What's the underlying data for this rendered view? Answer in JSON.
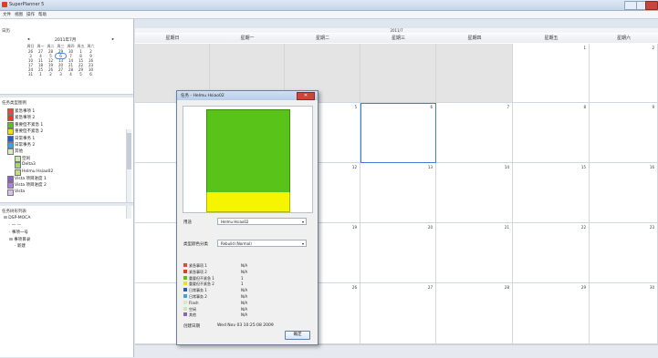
{
  "window": {
    "title": "SuperPlanner 5"
  },
  "menu": [
    "文件",
    "视图",
    "操作",
    "帮助"
  ],
  "sidebar": {
    "calendar_title": "日历",
    "mini_calendar": {
      "month_label": "2011年7月",
      "prev": "◂",
      "next": "▸",
      "weekdays": [
        "周日",
        "周一",
        "周二",
        "周三",
        "周四",
        "周五",
        "周六"
      ],
      "weeks": [
        [
          "26",
          "27",
          "28",
          "29",
          "30",
          "1",
          "2"
        ],
        [
          "3",
          "4",
          "5",
          "6",
          "7",
          "8",
          "9"
        ],
        [
          "10",
          "11",
          "12",
          "13",
          "14",
          "15",
          "16"
        ],
        [
          "17",
          "18",
          "19",
          "20",
          "21",
          "22",
          "23"
        ],
        [
          "24",
          "25",
          "26",
          "27",
          "28",
          "29",
          "30"
        ],
        [
          "31",
          "1",
          "2",
          "3",
          "4",
          "5",
          "6"
        ]
      ],
      "today": "6"
    },
    "categories_title": "任务类型图例",
    "categories": [
      {
        "label": "紧急事项 1",
        "color": "#e8483c",
        "indent": 0
      },
      {
        "label": "紧急事项 2",
        "color": "#e04020",
        "indent": 0
      },
      {
        "label": "重要但不紧急 1",
        "color": "#5ac31a",
        "indent": 0
      },
      {
        "label": "重要但不紧急 2",
        "color": "#f0e010",
        "indent": 0
      },
      {
        "label": "日常事务 1",
        "color": "#2060c0",
        "indent": 0
      },
      {
        "label": "日常事务 2",
        "color": "#40a0e0",
        "indent": 0
      },
      {
        "label": "其他",
        "color": "#d8e8c8",
        "indent": 0
      },
      {
        "label": "空闲",
        "color": "#c8e8b0",
        "indent": 1
      },
      {
        "label": "Delta3",
        "color": "#a0d870",
        "indent": 1
      },
      {
        "label": "Helmu Hsiao02",
        "color": "#c0e080",
        "indent": 1
      },
      {
        "label": "Vista 项目进度 1",
        "color": "#9060c0",
        "indent": 0
      },
      {
        "label": "Vista 项目进度 2",
        "color": "#b080e0",
        "indent": 0
      },
      {
        "label": "Vista",
        "color": "#d8c0f0",
        "indent": 0
      }
    ],
    "tree_title": "任务树形列表",
    "tree": [
      {
        "label": "⊟ DSP-MOCA",
        "indent": 0
      },
      {
        "label": "· — —",
        "indent": 1
      },
      {
        "label": "· 事项一号",
        "indent": 1
      },
      {
        "label": "⊟ 事项目录",
        "indent": 1
      },
      {
        "label": "· 新建",
        "indent": 2
      }
    ]
  },
  "calendar": {
    "date_label": "2011/7",
    "day_headers": [
      "星期日",
      "星期一",
      "星期二",
      "星期三",
      "星期四",
      "星期五",
      "星期六"
    ],
    "rows": [
      [
        {
          "n": "",
          "g": true
        },
        {
          "n": "",
          "g": true
        },
        {
          "n": "",
          "g": true
        },
        {
          "n": "",
          "g": true
        },
        {
          "n": "",
          "g": true
        },
        {
          "n": "1",
          "g": false
        },
        {
          "n": "2",
          "g": false
        }
      ],
      [
        {
          "n": "3",
          "g": false
        },
        {
          "n": "4",
          "g": false
        },
        {
          "n": "5",
          "g": false
        },
        {
          "n": "6",
          "g": false,
          "sel": true
        },
        {
          "n": "7",
          "g": false
        },
        {
          "n": "8",
          "g": false
        },
        {
          "n": "9",
          "g": false
        }
      ],
      [
        {
          "n": "10",
          "g": false
        },
        {
          "n": "11",
          "g": false
        },
        {
          "n": "12",
          "g": false
        },
        {
          "n": "13",
          "g": false
        },
        {
          "n": "14",
          "g": false
        },
        {
          "n": "15",
          "g": false
        },
        {
          "n": "16",
          "g": false
        }
      ],
      [
        {
          "n": "17",
          "g": false
        },
        {
          "n": "18",
          "g": false
        },
        {
          "n": "19",
          "g": false
        },
        {
          "n": "20",
          "g": false
        },
        {
          "n": "21",
          "g": false
        },
        {
          "n": "22",
          "g": false
        },
        {
          "n": "23",
          "g": false
        }
      ],
      [
        {
          "n": "24",
          "g": false
        },
        {
          "n": "25",
          "g": false
        },
        {
          "n": "26",
          "g": false
        },
        {
          "n": "27",
          "g": false
        },
        {
          "n": "28",
          "g": false
        },
        {
          "n": "29",
          "g": false
        },
        {
          "n": "30",
          "g": false
        }
      ]
    ]
  },
  "dialog": {
    "title": "任务 - Helmu Hsiao02",
    "close_label": "✕",
    "field1_label": "用途",
    "field1_value": "Helmu Hsiao02",
    "field2_label": "类型颜色分类",
    "field2_value": "Rebuild (Normal)",
    "legend": [
      {
        "color": "#e8483c",
        "label": "紧急事项 1",
        "value": "N/A"
      },
      {
        "color": "#e04020",
        "label": "紧急事项 2",
        "value": "N/A"
      },
      {
        "color": "#5ac31a",
        "label": "重要但不紧急 1",
        "value": "1"
      },
      {
        "color": "#f0e010",
        "label": "重要但不紧急 2",
        "value": "1"
      },
      {
        "color": "#2060c0",
        "label": "日常事务 1",
        "value": "N/A"
      },
      {
        "color": "#40a0e0",
        "label": "日常事务 2",
        "value": "N/A"
      },
      {
        "color": "#d8e8c8",
        "label": "Flash",
        "value": "N/A"
      },
      {
        "color": "#c8e8b0",
        "label": "空闲",
        "value": "N/A"
      },
      {
        "color": "#9060c0",
        "label": "其他",
        "value": "N/A"
      }
    ],
    "timestamp_label": "创建日期",
    "timestamp_value": "Wed Nov 03 10:25:08 2009",
    "ok_label": "确定",
    "bar_colors": {
      "top": "#5ac31a",
      "bottom": "#f5f500"
    }
  }
}
